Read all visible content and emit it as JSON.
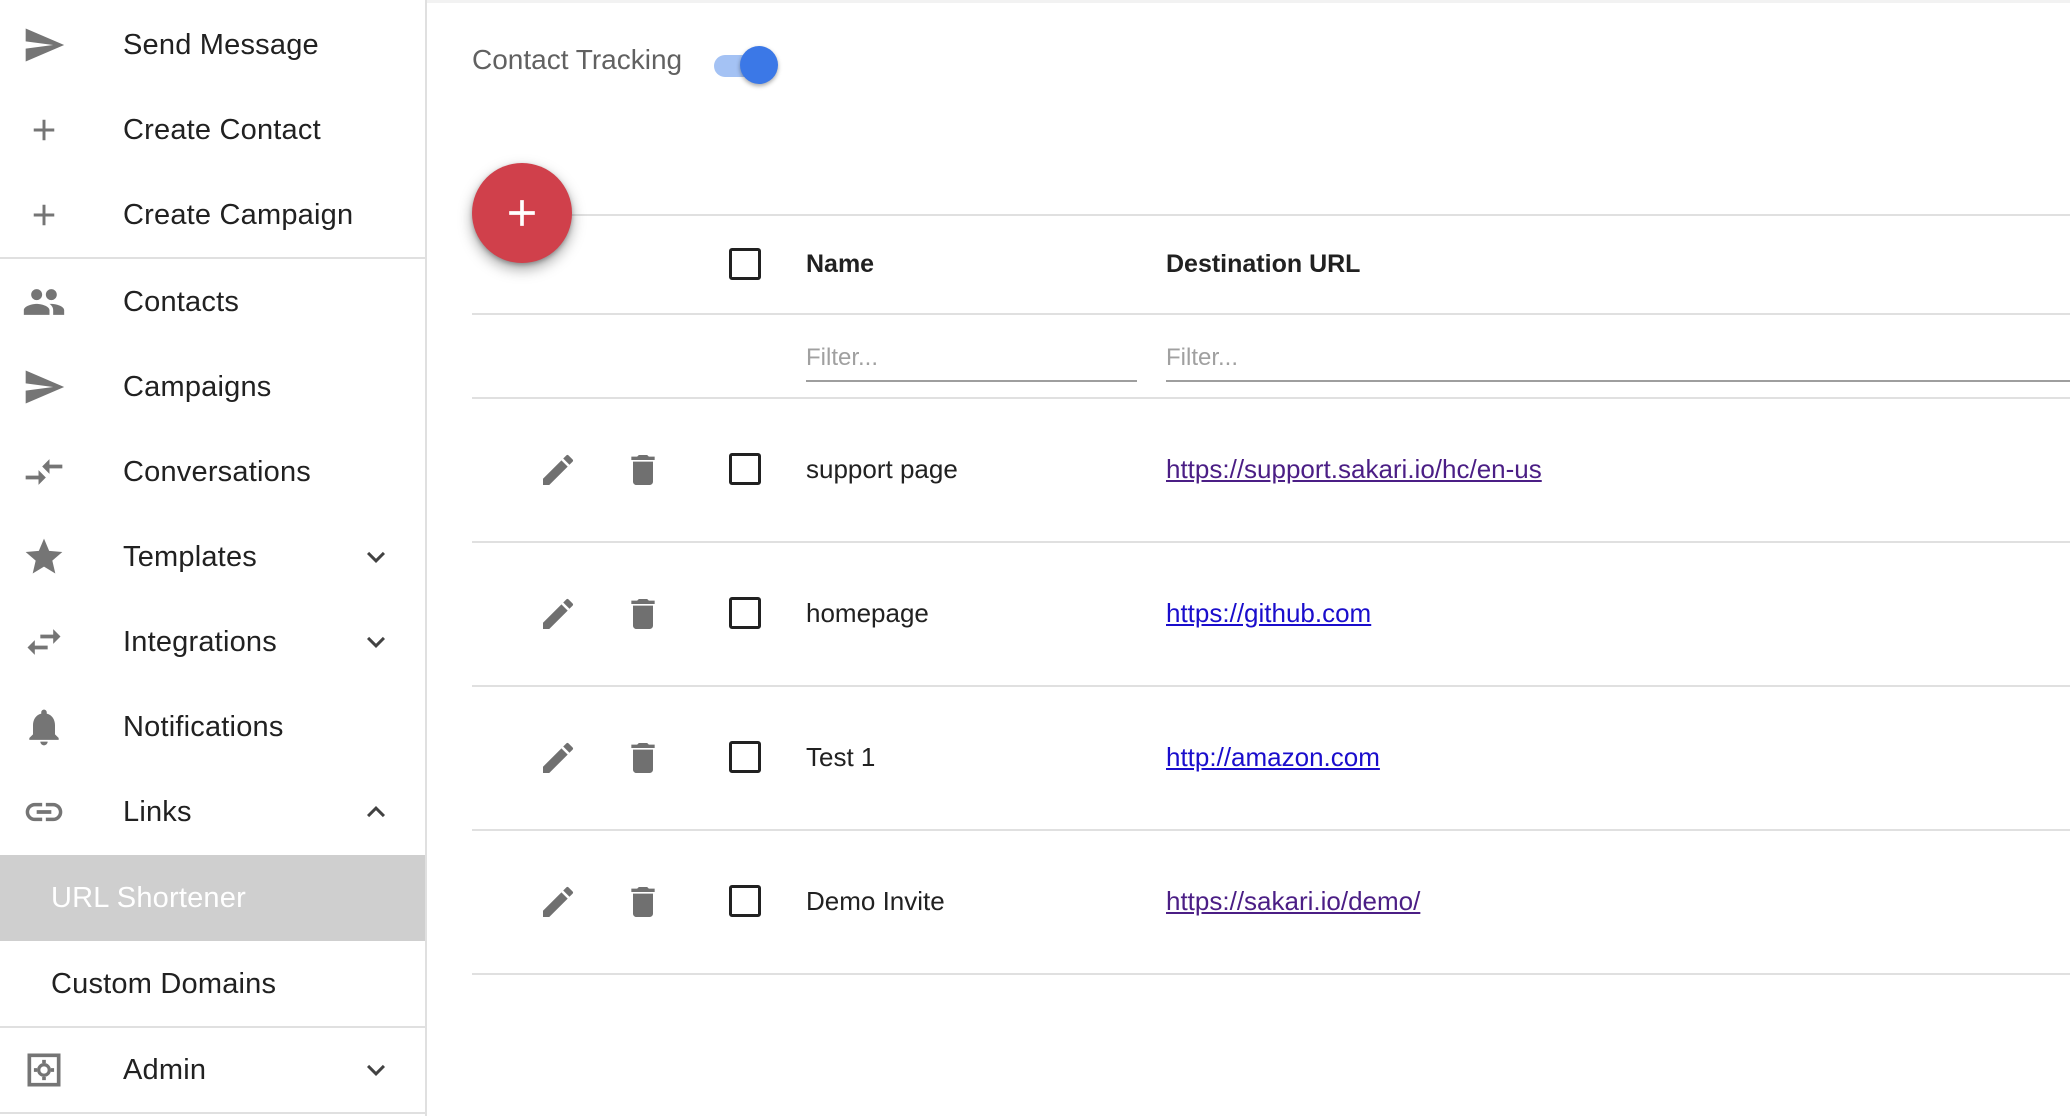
{
  "sidebar": {
    "items": [
      {
        "label": "Send Message",
        "icon": "send-icon"
      },
      {
        "label": "Create Contact",
        "icon": "plus-icon"
      },
      {
        "label": "Create Campaign",
        "icon": "plus-icon"
      },
      {
        "label": "Contacts",
        "icon": "people-icon"
      },
      {
        "label": "Campaigns",
        "icon": "send-icon"
      },
      {
        "label": "Conversations",
        "icon": "compare-arrows-icon"
      },
      {
        "label": "Templates",
        "icon": "star-icon"
      },
      {
        "label": "Integrations",
        "icon": "swap-arrows-icon"
      },
      {
        "label": "Notifications",
        "icon": "bell-icon"
      },
      {
        "label": "Links",
        "icon": "link-icon"
      },
      {
        "label": "Admin",
        "icon": "settings-box-icon"
      }
    ],
    "links_submenu": [
      {
        "label": "URL Shortener",
        "active": true
      },
      {
        "label": "Custom Domains",
        "active": false
      }
    ]
  },
  "main": {
    "contact_tracking": {
      "label": "Contact Tracking",
      "enabled": true
    },
    "table": {
      "headers": {
        "name": "Name",
        "destination_url": "Destination URL"
      },
      "filters": {
        "name_placeholder": "Filter...",
        "url_placeholder": "Filter..."
      },
      "rows": [
        {
          "name": "support page",
          "url": "https://support.sakari.io/hc/en-us",
          "visited": true
        },
        {
          "name": "homepage",
          "url": "https://github.com",
          "visited": false
        },
        {
          "name": "Test 1",
          "url": "http://amazon.com",
          "visited": false
        },
        {
          "name": "Demo Invite",
          "url": "https://sakari.io/demo/",
          "visited": true
        }
      ]
    }
  },
  "colors": {
    "fab": "#d0404b",
    "toggle_thumb": "#3b78e7",
    "toggle_track": "#a4c2f4",
    "active_submenu_bg": "#cfcfcf",
    "visited_link": "#4b1e85",
    "unvisited_link": "#1a0dcc"
  }
}
